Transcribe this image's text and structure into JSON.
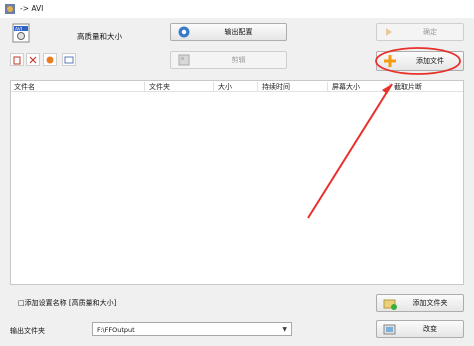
{
  "window": {
    "title": "-> AVI"
  },
  "preset": {
    "label": "高质量和大小"
  },
  "toolbar": {
    "output_config_label": "输出配置",
    "ok_label": "确定",
    "clip_label": "剪辑",
    "add_file_label": "添加文件"
  },
  "table": {
    "columns": [
      "文件名",
      "文件夹",
      "大小",
      "持续时间",
      "屏幕大小",
      "截取片断"
    ]
  },
  "options": {
    "add_preset_name_label": "□添加设置名称 [高质量和大小]"
  },
  "bottom": {
    "add_folder_label": "添加文件夹",
    "change_label": "改变",
    "output_folder_label": "输出文件夹",
    "output_folder_value": "F:\\FFOutput"
  },
  "colors": {
    "annotation": "#e8312b",
    "accent_orange": "#f39c12"
  }
}
